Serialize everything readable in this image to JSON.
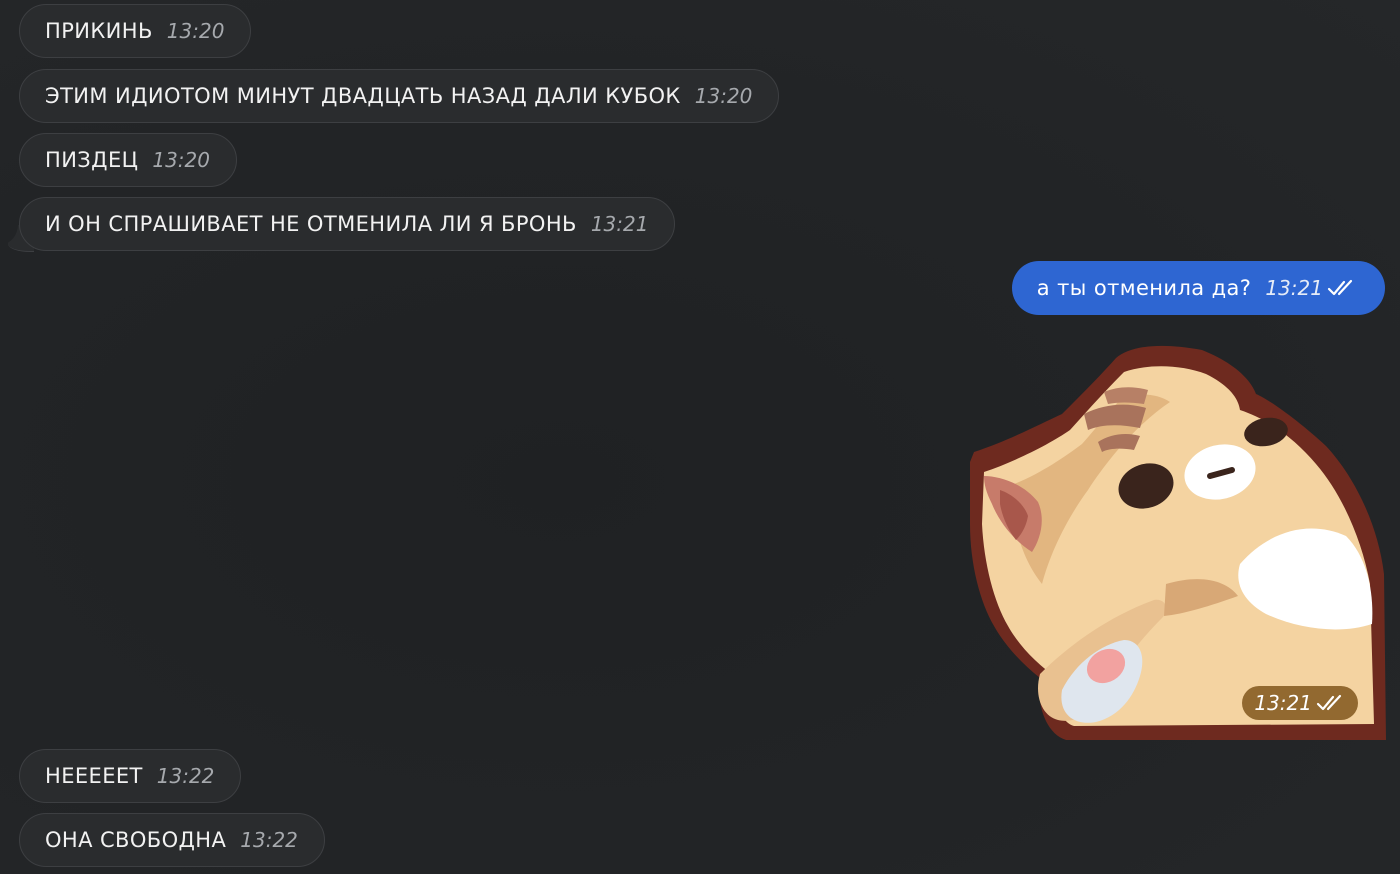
{
  "messages": [
    {
      "text": "ПРИКИНЬ",
      "time": "13:20"
    },
    {
      "text": "ЭТИМ ИДИОТОМ МИНУТ ДВАДЦАТЬ НАЗАД ДАЛИ КУБОК",
      "time": "13:20"
    },
    {
      "text": "ПИЗДЕЦ",
      "time": "13:20"
    },
    {
      "text": "И ОН СПРАШИВАЕТ НЕ ОТМЕНИЛА ЛИ Я БРОНЬ",
      "time": "13:21"
    },
    {
      "text": "а ты отменила да?",
      "time": "13:21",
      "status_icon": "double-check-icon"
    },
    {
      "sticker": "cat-sticker",
      "time": "13:21",
      "status_icon": "double-check-icon"
    },
    {
      "text": "НЕЕЕЕЕТ",
      "time": "13:22"
    },
    {
      "text": "ОНА СВОБОДНА",
      "time": "13:22"
    }
  ],
  "colors": {
    "background": "#222426",
    "incoming_bubble": "#2a2c2e",
    "outgoing_bubble": "#2e66d2",
    "sticker_time_badge": "#80561c"
  }
}
